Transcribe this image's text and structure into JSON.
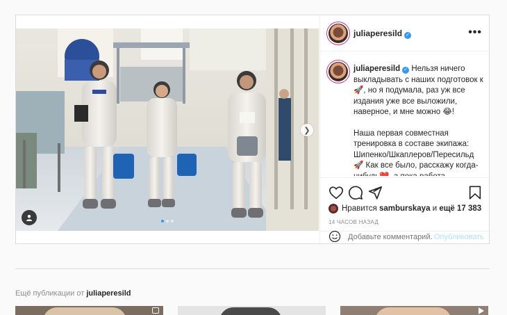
{
  "post": {
    "username": "juliaperesild",
    "verified_symbol": "✓",
    "more_symbol": "•••",
    "caption": {
      "username": "juliaperesild",
      "part1": "Нельзя ничего выкладывать с наших подготовок к 🚀, но я подумала, раз уж все издания уже все выложили, наверное, и мне можно 😂!",
      "part2": "Наша первая совместная тренировка в составе экипажа: Шипенко/Шкаплеров/Пересильд 🚀 Как все было, расскажу когда-нибудь❤️, а пока работа-"
    },
    "likes": {
      "prefix": "Нравится",
      "user": "samburskaya",
      "connector": "и",
      "others": "ещё 17 383"
    },
    "timestamp": "14 часов назад",
    "comment": {
      "placeholder": "Добавьте комментарий...",
      "publish_label": "Опубликовать"
    },
    "carousel": {
      "slide_count": 3,
      "active_slide": 1
    }
  },
  "more_posts": {
    "prefix": "Ещё публикации от",
    "username": "juliaperesild"
  },
  "colors": {
    "accent": "#3897f0",
    "border": "#dbdbdb",
    "background": "#fafafa",
    "muted": "#8e8e8e"
  }
}
